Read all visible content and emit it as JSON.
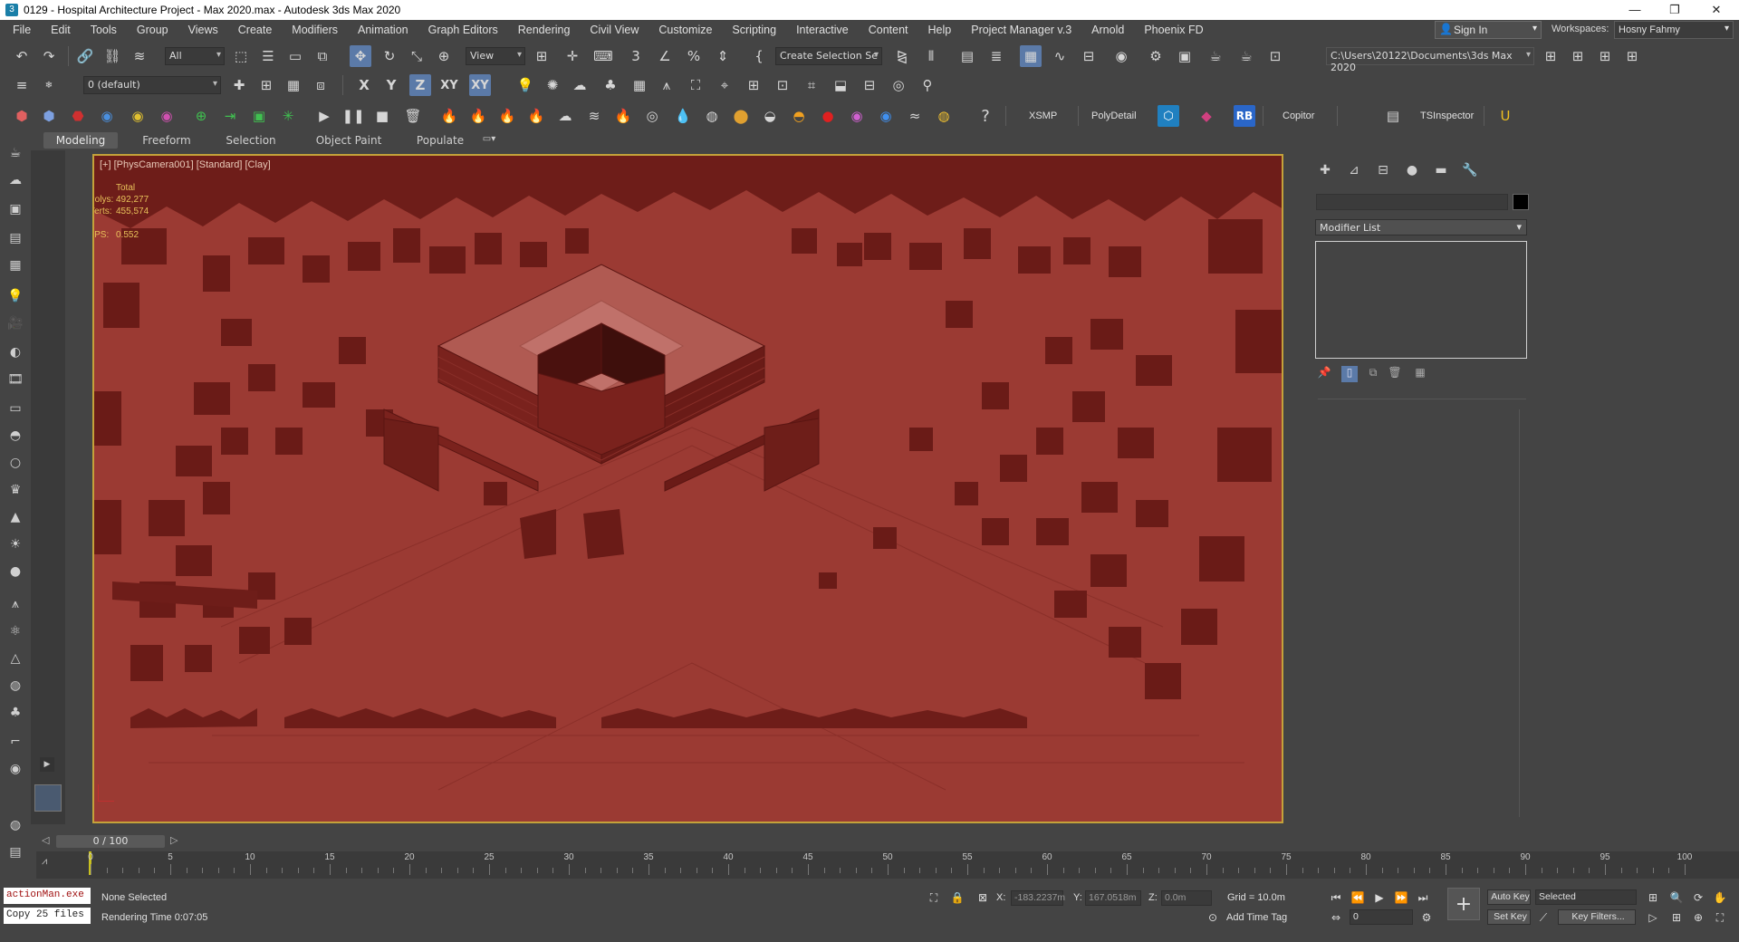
{
  "window": {
    "title": "0129 - Hospital Architecture Project - Max 2020.max - Autodesk 3ds Max 2020",
    "minimize": "—",
    "restore": "❐",
    "close": "✕"
  },
  "menu": [
    "File",
    "Edit",
    "Tools",
    "Group",
    "Views",
    "Create",
    "Modifiers",
    "Animation",
    "Graph Editors",
    "Rendering",
    "Civil View",
    "Customize",
    "Scripting",
    "Interactive",
    "Content",
    "Help",
    "Project Manager v.3",
    "Arnold",
    "Phoenix FD"
  ],
  "account": {
    "sign_in": "Sign In",
    "workspaces_label": "Workspaces:",
    "workspace": "Hosny Fahmy"
  },
  "main_toolbar": {
    "selection_filter": "All",
    "ref_coord": "View",
    "named_selection": "Create Selection Se",
    "project_path": "C:\\Users\\20122\\Documents\\3ds Max 2020"
  },
  "layer_toolbar": {
    "layer": "0 (default)",
    "axis_x": "X",
    "axis_y": "Y",
    "axis_z": "Z",
    "axis_xy": "XY",
    "axis_xyz": "XY"
  },
  "plugin_toolbar": {
    "xsmp": "XSMP",
    "polydetail": "PolyDetail",
    "rb": "RB",
    "copitor": "Copitor",
    "tsinspector": "TSInspector",
    "help": "?"
  },
  "ribbon_tabs": [
    "Modeling",
    "Freeform",
    "Selection",
    "Object Paint",
    "Populate"
  ],
  "viewport": {
    "label": "[+] [PhysCamera001] [Standard] [Clay]",
    "stats_total": "Total",
    "polys_label": "Polys:",
    "polys": "492,277",
    "verts_label": "Verts:",
    "verts": "455,574",
    "fps_label": "FPS:",
    "fps": "0.552",
    "background_color": "#9b3a33",
    "frame_color": "#c4a23a"
  },
  "command_panel": {
    "modifier_list": "Modifier List"
  },
  "time_slider": {
    "frame": "0 / 100",
    "ticks": [
      "0",
      "5",
      "10",
      "15",
      "20",
      "25",
      "30",
      "35",
      "40",
      "45",
      "50",
      "55",
      "60",
      "65",
      "70",
      "75",
      "80",
      "85",
      "90",
      "95",
      "100"
    ]
  },
  "status": {
    "maxscript_line1": "actionMan.exe",
    "maxscript_line2": "Copy 25 files",
    "selection": "None Selected",
    "render_time": "Rendering Time  0:07:05",
    "x_label": "X:",
    "x_value": "-183.2237m",
    "y_label": "Y:",
    "y_value": "167.0518m",
    "z_label": "Z:",
    "z_value": "0.0m",
    "grid": "Grid = 10.0m",
    "add_time_tag": "Add Time Tag",
    "auto_key": "Auto Key",
    "set_key": "Set Key",
    "key_mode": "Selected",
    "key_filters": "Key Filters...",
    "current_frame": "0"
  }
}
